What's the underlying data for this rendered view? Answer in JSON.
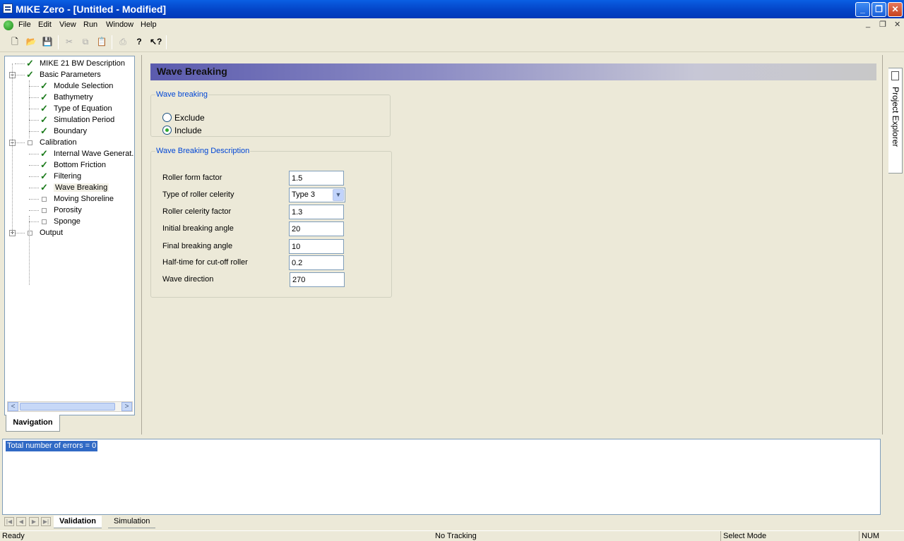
{
  "window": {
    "title": "MIKE Zero - [Untitled - Modified]"
  },
  "menu": [
    "File",
    "Edit",
    "View",
    "Run",
    "Window",
    "Help"
  ],
  "toolbar": {
    "icons": [
      "new-icon",
      "open-icon",
      "save-icon",
      "cut-icon",
      "copy-icon",
      "paste-icon",
      "print-icon",
      "help-icon",
      "context-help-icon"
    ]
  },
  "nav": {
    "tab": "Navigation",
    "tree": [
      {
        "label": "MIKE 21 BW Description",
        "checked": true,
        "level": 0
      },
      {
        "label": "Basic Parameters",
        "checked": true,
        "level": 0,
        "expander": "-"
      },
      {
        "label": "Module Selection",
        "checked": true,
        "level": 1
      },
      {
        "label": "Bathymetry",
        "checked": true,
        "level": 1
      },
      {
        "label": "Type of Equation",
        "checked": true,
        "level": 1
      },
      {
        "label": "Simulation Period",
        "checked": true,
        "level": 1
      },
      {
        "label": "Boundary",
        "checked": true,
        "level": 1
      },
      {
        "label": "Calibration",
        "checked": false,
        "level": 0,
        "expander": "-"
      },
      {
        "label": "Internal Wave Generat...",
        "checked": true,
        "level": 1
      },
      {
        "label": "Bottom Friction",
        "checked": true,
        "level": 1
      },
      {
        "label": "Filtering",
        "checked": true,
        "level": 1
      },
      {
        "label": "Wave Breaking",
        "checked": true,
        "level": 1,
        "selected": true
      },
      {
        "label": "Moving Shoreline",
        "checked": false,
        "level": 1
      },
      {
        "label": "Porosity",
        "checked": false,
        "level": 1
      },
      {
        "label": "Sponge",
        "checked": false,
        "level": 1
      },
      {
        "label": "Output",
        "checked": false,
        "level": 0,
        "expander": "+"
      }
    ]
  },
  "content": {
    "header": "Wave Breaking",
    "group1": {
      "legend": "Wave breaking",
      "options": [
        "Exclude",
        "Include"
      ],
      "selected": "Include"
    },
    "group2": {
      "legend": "Wave Breaking Description",
      "fields": [
        {
          "label": "Roller form factor",
          "value": "1.5",
          "type": "text"
        },
        {
          "label": "Type of roller celerity",
          "value": "Type 3",
          "type": "select"
        },
        {
          "label": "Roller celerity factor",
          "value": "1.3",
          "type": "text"
        },
        {
          "label": "Initial breaking angle",
          "value": "20",
          "type": "text"
        },
        {
          "label": "Final breaking angle",
          "value": "10",
          "type": "text"
        },
        {
          "label": "Half-time for cut-off roller",
          "value": "0.2",
          "type": "text"
        },
        {
          "label": "Wave direction",
          "value": "270",
          "type": "text"
        }
      ]
    }
  },
  "right": {
    "tab": "Project Explorer"
  },
  "output": {
    "message": "Total number of errors = 0",
    "tabs": [
      "Validation",
      "Simulation"
    ]
  },
  "status": {
    "left": "Ready",
    "tracking": "No Tracking",
    "mode": "Select Mode",
    "num": "NUM"
  }
}
